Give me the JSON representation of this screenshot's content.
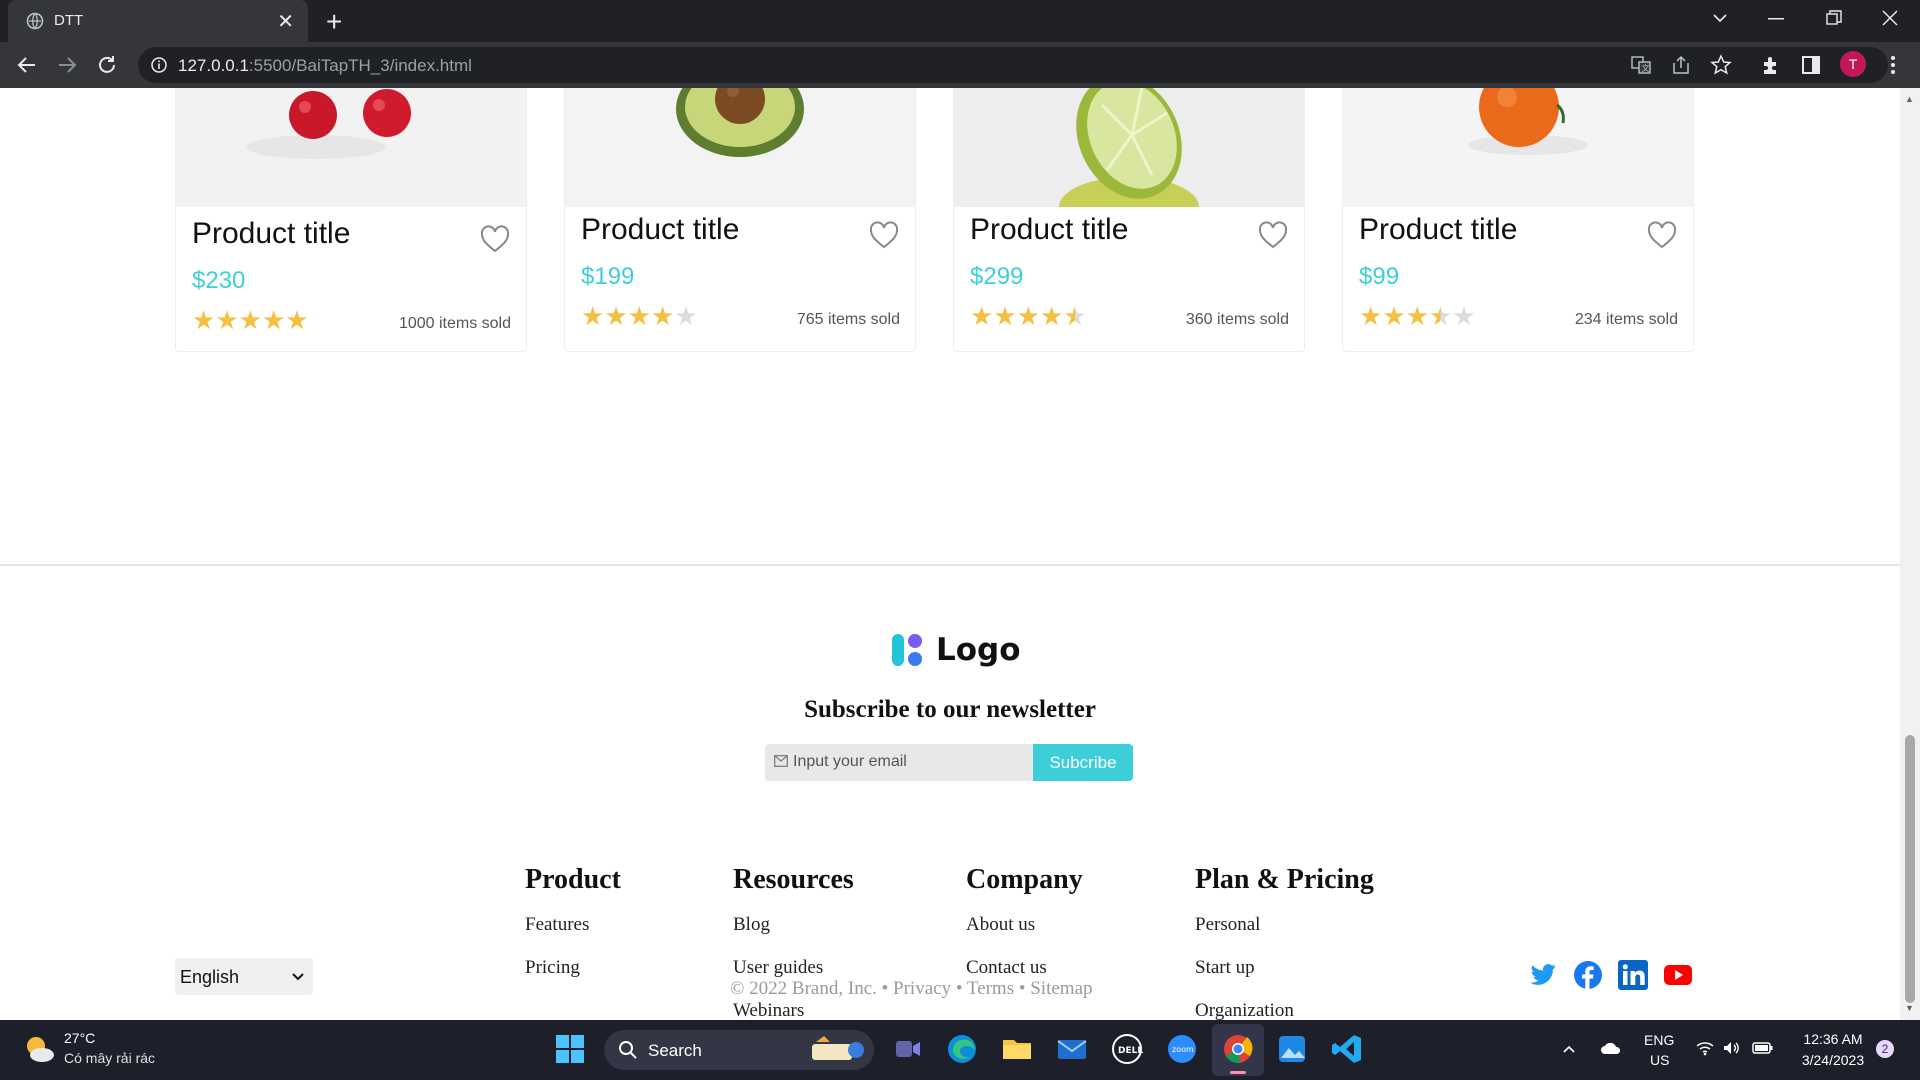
{
  "browser": {
    "tab_title": "DTT",
    "close_tab": "✕",
    "new_tab": "+",
    "url_host": "127.0.0.1",
    "url_path": ":5500/BaiTapTH_3/index.html",
    "avatar_letter": "T"
  },
  "products": [
    {
      "title": "Product title",
      "price": "$230",
      "rating": 5,
      "sold": "1000 items sold",
      "fruit": "cherry"
    },
    {
      "title": "Product title",
      "price": "$199",
      "rating": 4,
      "sold": "765 items sold",
      "fruit": "avocado"
    },
    {
      "title": "Product title",
      "price": "$299",
      "rating": 4.5,
      "sold": "360 items sold",
      "fruit": "lime"
    },
    {
      "title": "Product title",
      "price": "$99",
      "rating": 3.5,
      "sold": "234 items sold",
      "fruit": "orange"
    }
  ],
  "footer": {
    "logo_text": "Logo",
    "newsletter_heading": "Subscribe to our newsletter",
    "email_placeholder": "Input your email",
    "subscribe_label": "Subcribe",
    "columns": [
      {
        "heading": "Product",
        "links": [
          "Features",
          "Pricing"
        ]
      },
      {
        "heading": "Resources",
        "links": [
          "Blog",
          "User guides",
          "Webinars"
        ]
      },
      {
        "heading": "Company",
        "links": [
          "About us",
          "Contact us"
        ]
      },
      {
        "heading": "Plan & Pricing",
        "links": [
          "Personal",
          "Start up",
          "Organization"
        ]
      }
    ],
    "language": "English",
    "copyright": "© 2022 Brand, Inc. • Privacy • Terms • Sitemap",
    "social": [
      "twitter-icon",
      "facebook-icon",
      "linkedin-icon",
      "youtube-icon"
    ]
  },
  "taskbar": {
    "temperature": "27°C",
    "weather_desc": "Có mây rải rác",
    "search_label": "Search",
    "lang_top": "ENG",
    "lang_bottom": "US",
    "time": "12:36 AM",
    "date": "3/24/2023",
    "notification_count": "2"
  },
  "colors": {
    "accent": "#3ccfd9",
    "star": "#f5bf42",
    "brand_pink": "#c2185b"
  }
}
